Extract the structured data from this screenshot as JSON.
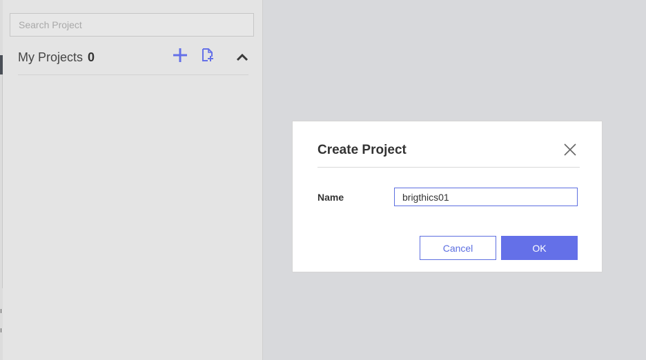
{
  "sidebar": {
    "search": {
      "placeholder": "Search Project",
      "value": ""
    },
    "projects": {
      "title": "My Projects",
      "count": "0",
      "add_icon": "plus-icon",
      "import_icon": "file-import-icon",
      "collapse_icon": "chevron-up-icon"
    }
  },
  "dialog": {
    "title": "Create Project",
    "close_icon": "close-icon",
    "name_label": "Name",
    "name_value": "brigthics01",
    "cancel_label": "Cancel",
    "ok_label": "OK"
  },
  "colors": {
    "accent": "#6470e8",
    "panel_bg": "#e4e4e4",
    "workspace_bg": "#d8d9dc"
  }
}
